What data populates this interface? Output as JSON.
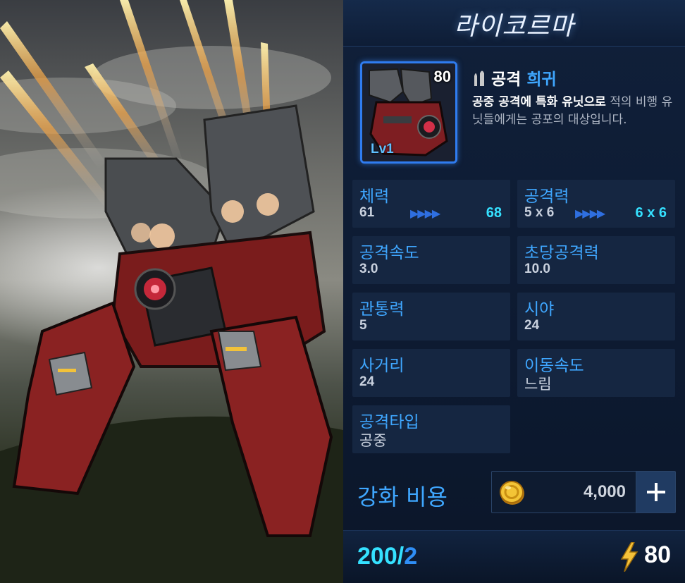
{
  "unit": {
    "name": "라이코르마",
    "portrait_level": "80",
    "portrait_lv_label": "Lv1",
    "type": "공격",
    "rarity": "희귀",
    "description_highlight": "공중 공격에 특화 유닛으로",
    "description_rest": " 적의 비행 유닛들에게는 공포의 대상입니다."
  },
  "stats": [
    {
      "label": "체력",
      "value": "61",
      "arrows": "▶▶▶▶",
      "next": "68"
    },
    {
      "label": "공격력",
      "value": "5 x 6",
      "arrows": "▶▶▶▶",
      "next": "6 x 6"
    },
    {
      "label": "공격속도",
      "value": "3.0"
    },
    {
      "label": "초당공격력",
      "value": "10.0"
    },
    {
      "label": "관통력",
      "value": "5"
    },
    {
      "label": "시야",
      "value": "24"
    },
    {
      "label": "사거리",
      "value": "24"
    },
    {
      "label": "이동속도",
      "value": "느림"
    },
    {
      "label": "공격타입",
      "value": "공중"
    }
  ],
  "upgrade": {
    "label": "강화 비용",
    "cost": "4,000",
    "coin_icon": "gold-coin-icon",
    "plus_icon": "plus-icon"
  },
  "footer": {
    "count_current": "200",
    "count_sep": "/",
    "count_max": "2",
    "energy": "80",
    "energy_icon": "lightning-bolt-icon"
  },
  "colors": {
    "accent_blue": "#3fa7ff",
    "cyan": "#35e1ff",
    "panel_bg": "#10203a",
    "stat_bg": "#152641",
    "portrait_border": "#2f7cf0"
  }
}
